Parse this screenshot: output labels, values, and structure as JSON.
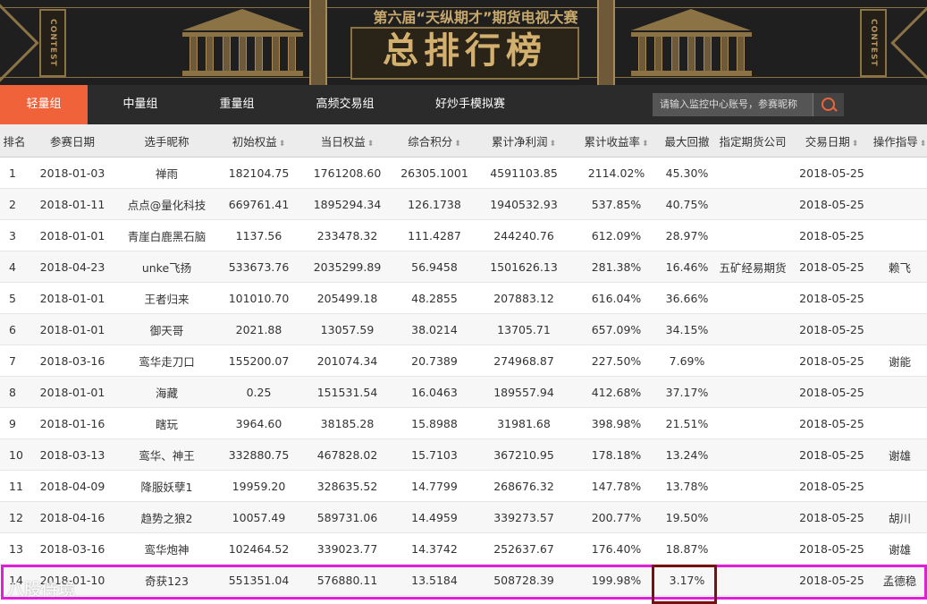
{
  "banner": {
    "subtitle": "第六届“天纵期才”期货电视大赛",
    "title": "总排行榜",
    "badge_text": "CONTEST"
  },
  "nav": {
    "tabs": [
      {
        "label": "轻量组",
        "active": true
      },
      {
        "label": "中量组",
        "active": false
      },
      {
        "label": "重量组",
        "active": false
      },
      {
        "label": "高频交易组",
        "active": false
      },
      {
        "label": "好炒手模拟赛",
        "active": false
      }
    ],
    "search_placeholder": "请输入监控中心账号，参赛昵称",
    "search_icon": "search-icon"
  },
  "colors": {
    "accent": "#f0633a",
    "nav_bg": "#2b2b2b",
    "banner_bg": "#1f1f1f",
    "gold": "#c9a86b",
    "highlight_row": "#e020d8",
    "highlight_cell": "#7a0f0f"
  },
  "table": {
    "headers": [
      {
        "label": "排名",
        "sort": false
      },
      {
        "label": "参赛日期",
        "sort": false
      },
      {
        "label": "选手昵称",
        "sort": false
      },
      {
        "label": "初始权益",
        "sort": true
      },
      {
        "label": "当日权益",
        "sort": true
      },
      {
        "label": "综合积分",
        "sort": true
      },
      {
        "label": "累计净利润",
        "sort": true
      },
      {
        "label": "累计收益率",
        "sort": true
      },
      {
        "label": "最大回撤",
        "sort": false
      },
      {
        "label": "指定期货公司",
        "sort": false
      },
      {
        "label": "交易日期",
        "sort": true
      },
      {
        "label": "操作指导",
        "sort": true
      }
    ],
    "rows": [
      [
        "1",
        "2018-01-03",
        "禅雨",
        "182104.75",
        "1761208.60",
        "26305.1001",
        "4591103.85",
        "2114.02%",
        "45.30%",
        "",
        "2018-05-25",
        ""
      ],
      [
        "2",
        "2018-01-11",
        "点点@量化科技",
        "669761.41",
        "1895294.34",
        "126.1738",
        "1940532.93",
        "537.85%",
        "40.75%",
        "",
        "2018-05-25",
        ""
      ],
      [
        "3",
        "2018-01-01",
        "青崖白鹿黑石脑",
        "1137.56",
        "233478.32",
        "111.4287",
        "244240.76",
        "612.09%",
        "28.97%",
        "",
        "2018-05-25",
        ""
      ],
      [
        "4",
        "2018-04-23",
        "unke飞扬",
        "533673.76",
        "2035299.89",
        "56.9458",
        "1501626.13",
        "281.38%",
        "16.46%",
        "五矿经易期货",
        "2018-05-25",
        "赖飞"
      ],
      [
        "5",
        "2018-01-01",
        "王者归来",
        "101010.70",
        "205499.18",
        "48.2855",
        "207883.12",
        "616.04%",
        "36.66%",
        "",
        "2018-05-25",
        ""
      ],
      [
        "6",
        "2018-01-01",
        "御天哥",
        "2021.88",
        "13057.59",
        "38.0214",
        "13705.71",
        "657.09%",
        "34.15%",
        "",
        "2018-05-25",
        ""
      ],
      [
        "7",
        "2018-03-16",
        "鸾华走刀口",
        "155200.07",
        "201074.34",
        "20.7389",
        "274968.87",
        "227.50%",
        "7.69%",
        "",
        "2018-05-25",
        "谢能"
      ],
      [
        "8",
        "2018-01-01",
        "海藏",
        "0.25",
        "151531.54",
        "16.0463",
        "189557.94",
        "412.68%",
        "37.17%",
        "",
        "2018-05-25",
        ""
      ],
      [
        "9",
        "2018-01-16",
        "瞎玩",
        "3964.60",
        "38185.28",
        "15.8988",
        "31981.68",
        "398.98%",
        "21.51%",
        "",
        "2018-05-25",
        ""
      ],
      [
        "10",
        "2018-03-13",
        "鸾华、神王",
        "332880.75",
        "467828.02",
        "15.7103",
        "367210.95",
        "178.18%",
        "13.24%",
        "",
        "2018-05-25",
        "谢雄"
      ],
      [
        "11",
        "2018-04-09",
        "降服妖孽1",
        "19959.20",
        "328635.52",
        "14.7799",
        "268676.32",
        "147.78%",
        "13.78%",
        "",
        "2018-05-25",
        ""
      ],
      [
        "12",
        "2018-04-16",
        "趋势之狼2",
        "10057.49",
        "589731.06",
        "14.4959",
        "339273.57",
        "200.77%",
        "19.50%",
        "",
        "2018-05-25",
        "胡川"
      ],
      [
        "13",
        "2018-03-16",
        "鸾华炮神",
        "102464.52",
        "339023.77",
        "14.3742",
        "252637.67",
        "176.40%",
        "18.87%",
        "",
        "2018-05-25",
        "谢雄"
      ],
      [
        "14",
        "2018-01-10",
        "奇获123",
        "551351.04",
        "576880.11",
        "13.5184",
        "508728.39",
        "199.98%",
        "3.17%",
        "",
        "2018-05-25",
        "孟德稳"
      ]
    ]
  },
  "watermark": "八股侍境"
}
